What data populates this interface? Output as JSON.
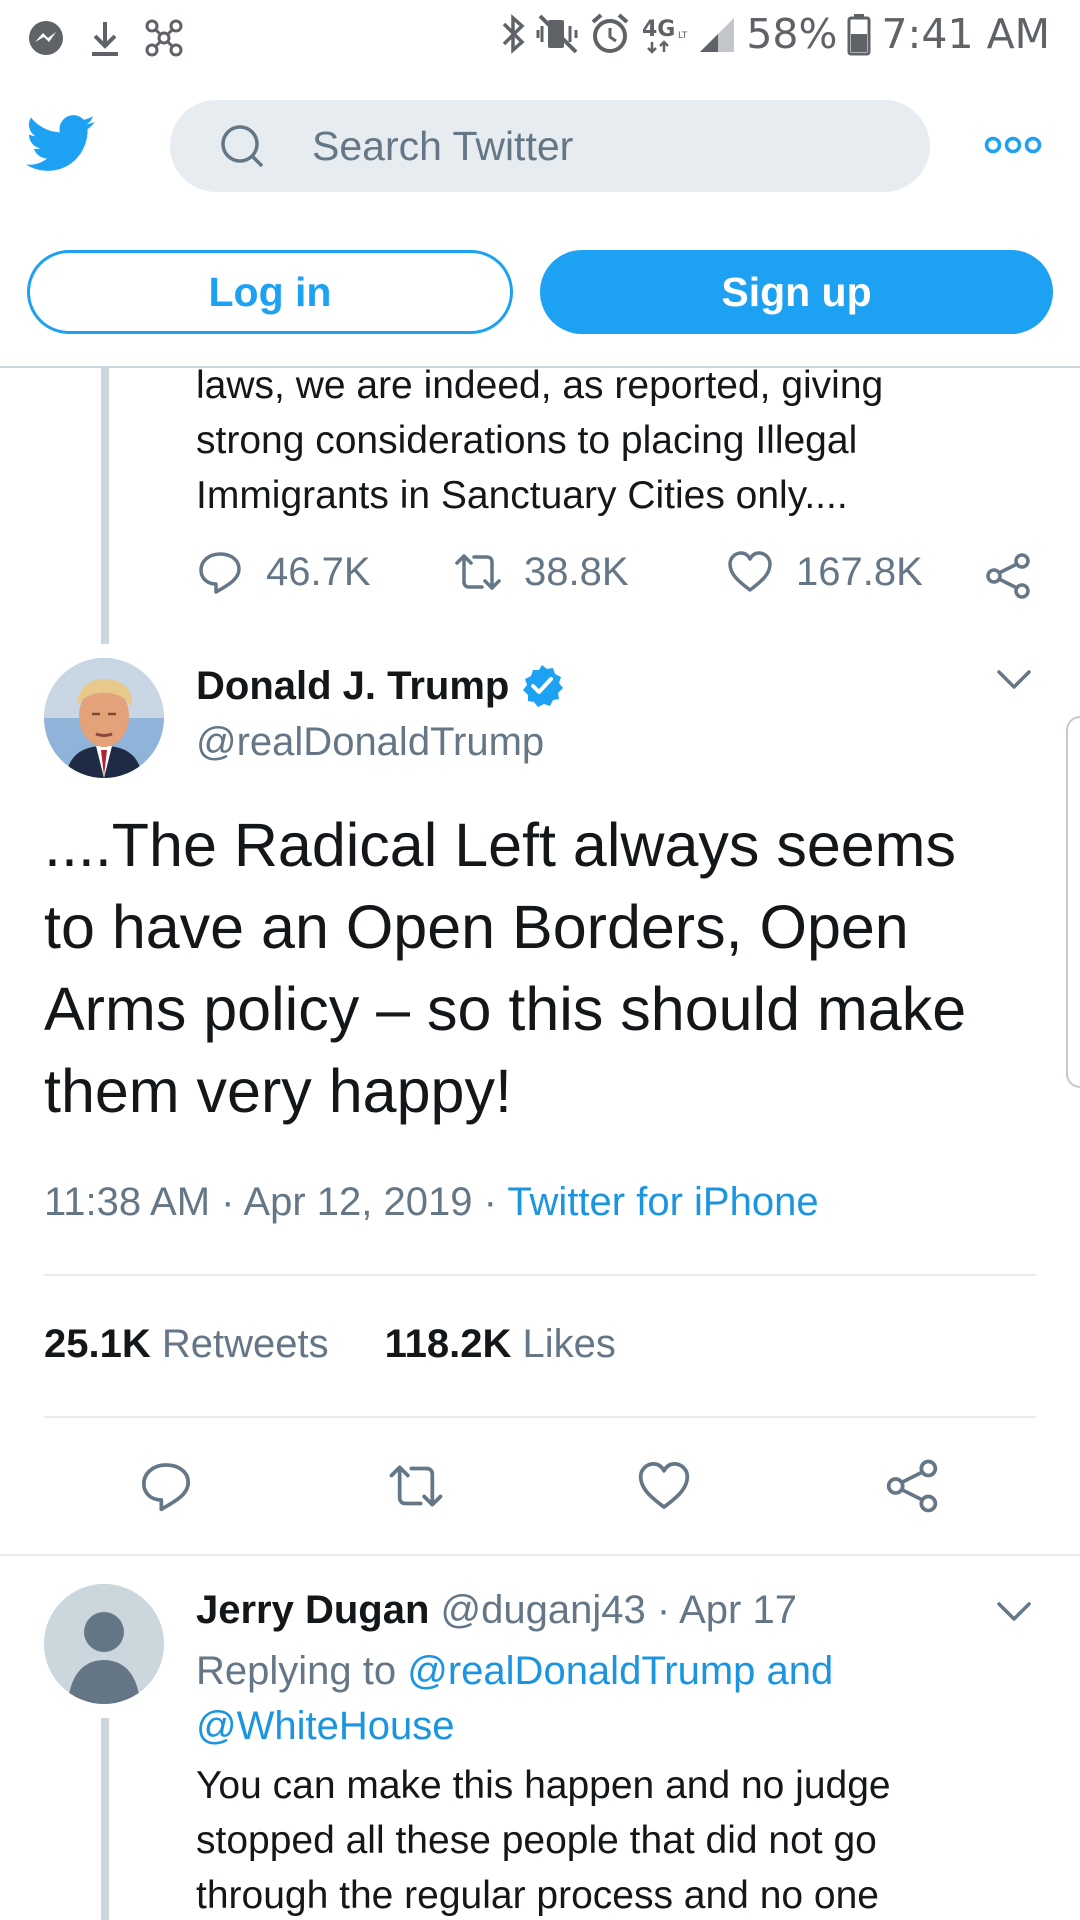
{
  "status_bar": {
    "battery": "58%",
    "time": "7:41 AM",
    "network": "4G",
    "icons": [
      "messenger-icon",
      "download-icon",
      "network-share-icon",
      "bluetooth-icon",
      "vibrate-icon",
      "alarm-icon",
      "4g-lte-icon",
      "signal-icon",
      "battery-icon"
    ]
  },
  "nav": {
    "search_placeholder": "Search Twitter",
    "icons": [
      "twitter-logo-icon",
      "search-icon",
      "more-icon"
    ]
  },
  "auth": {
    "login_label": "Log in",
    "signup_label": "Sign up"
  },
  "previous_tweet": {
    "text_lines": [
      "laws, we are indeed, as reported, giving",
      "strong considerations to placing Illegal",
      "Immigrants in Sanctuary Cities only...."
    ],
    "replies": "46.7K",
    "retweets": "38.8K",
    "likes": "167.8K"
  },
  "main_tweet": {
    "author_name": "Donald J. Trump",
    "handle": "@realDonaldTrump",
    "text_lines": [
      "....The Radical Left always seems",
      "to have an Open Borders, Open",
      "Arms policy – so this should make",
      "them very happy!"
    ],
    "time": "11:38 AM",
    "separator": "·",
    "date": "Apr 12, 2019",
    "source": "Twitter for iPhone",
    "retweets_count": "25.1K",
    "retweets_label": "Retweets",
    "likes_count": "118.2K",
    "likes_label": "Likes"
  },
  "reply": {
    "name": "Jerry Dugan",
    "handle": "@duganj43",
    "separator": "·",
    "date": "Apr 17",
    "replying_prefix": "Replying to",
    "replying_to_1": "@realDonaldTrump",
    "replying_and": "and",
    "replying_to_2": "@WhiteHouse",
    "text_lines": [
      "You can make this happen and no judge",
      "stopped all these people that did not go",
      "through the regular process and no one"
    ]
  },
  "colors": {
    "twitter_blue": "#1da1f2",
    "link_blue": "#1b95e0",
    "secondary_text": "#657786",
    "primary_text": "#14171a",
    "search_bg": "#e6ecf0"
  }
}
